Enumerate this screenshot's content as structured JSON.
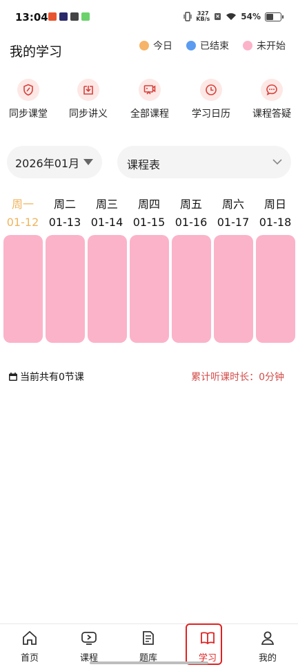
{
  "status_bar": {
    "time": "13:04",
    "net_speed_top": "327",
    "net_speed_bottom": "KB/s",
    "battery": "54%"
  },
  "header": {
    "title": "我的学习"
  },
  "legend": [
    {
      "label": "今日",
      "color": "#f5b467"
    },
    {
      "label": "已结束",
      "color": "#5b9cf0"
    },
    {
      "label": "未开始",
      "color": "#fbb3c9"
    }
  ],
  "quick_actions": [
    {
      "label": "同步课堂",
      "icon": "shield-pen-icon"
    },
    {
      "label": "同步讲义",
      "icon": "download-box-icon"
    },
    {
      "label": "全部课程",
      "icon": "projector-icon"
    },
    {
      "label": "学习日历",
      "icon": "clock-icon"
    },
    {
      "label": "课程答疑",
      "icon": "chat-bubble-icon"
    }
  ],
  "filters": {
    "month": "2026年01月",
    "type": "课程表"
  },
  "week": [
    {
      "day": "周一",
      "date": "01-12",
      "today": true
    },
    {
      "day": "周二",
      "date": "01-13",
      "today": false
    },
    {
      "day": "周三",
      "date": "01-14",
      "today": false
    },
    {
      "day": "周四",
      "date": "01-15",
      "today": false
    },
    {
      "day": "周五",
      "date": "01-16",
      "today": false
    },
    {
      "day": "周六",
      "date": "01-17",
      "today": false
    },
    {
      "day": "周日",
      "date": "01-18",
      "today": false
    }
  ],
  "summary": {
    "lessons": "当前共有0节课",
    "total_time": "累计听课时长：0分钟"
  },
  "bottom_nav": [
    {
      "label": "首页",
      "icon": "home-icon"
    },
    {
      "label": "课程",
      "icon": "play-icon"
    },
    {
      "label": "题库",
      "icon": "document-icon"
    },
    {
      "label": "学习",
      "icon": "book-icon",
      "active": true
    },
    {
      "label": "我的",
      "icon": "user-icon"
    }
  ]
}
